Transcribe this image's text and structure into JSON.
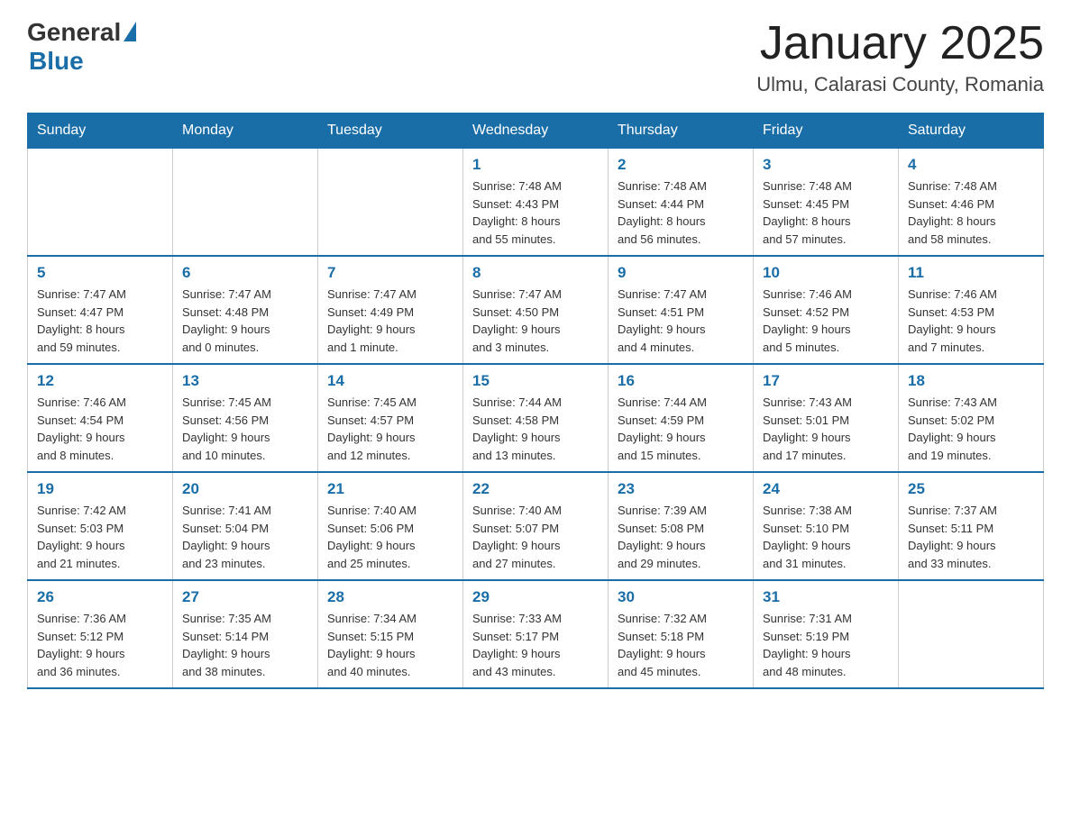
{
  "logo": {
    "general": "General",
    "blue": "Blue"
  },
  "title": "January 2025",
  "subtitle": "Ulmu, Calarasi County, Romania",
  "headers": [
    "Sunday",
    "Monday",
    "Tuesday",
    "Wednesday",
    "Thursday",
    "Friday",
    "Saturday"
  ],
  "weeks": [
    [
      {
        "day": "",
        "info": ""
      },
      {
        "day": "",
        "info": ""
      },
      {
        "day": "",
        "info": ""
      },
      {
        "day": "1",
        "info": "Sunrise: 7:48 AM\nSunset: 4:43 PM\nDaylight: 8 hours\nand 55 minutes."
      },
      {
        "day": "2",
        "info": "Sunrise: 7:48 AM\nSunset: 4:44 PM\nDaylight: 8 hours\nand 56 minutes."
      },
      {
        "day": "3",
        "info": "Sunrise: 7:48 AM\nSunset: 4:45 PM\nDaylight: 8 hours\nand 57 minutes."
      },
      {
        "day": "4",
        "info": "Sunrise: 7:48 AM\nSunset: 4:46 PM\nDaylight: 8 hours\nand 58 minutes."
      }
    ],
    [
      {
        "day": "5",
        "info": "Sunrise: 7:47 AM\nSunset: 4:47 PM\nDaylight: 8 hours\nand 59 minutes."
      },
      {
        "day": "6",
        "info": "Sunrise: 7:47 AM\nSunset: 4:48 PM\nDaylight: 9 hours\nand 0 minutes."
      },
      {
        "day": "7",
        "info": "Sunrise: 7:47 AM\nSunset: 4:49 PM\nDaylight: 9 hours\nand 1 minute."
      },
      {
        "day": "8",
        "info": "Sunrise: 7:47 AM\nSunset: 4:50 PM\nDaylight: 9 hours\nand 3 minutes."
      },
      {
        "day": "9",
        "info": "Sunrise: 7:47 AM\nSunset: 4:51 PM\nDaylight: 9 hours\nand 4 minutes."
      },
      {
        "day": "10",
        "info": "Sunrise: 7:46 AM\nSunset: 4:52 PM\nDaylight: 9 hours\nand 5 minutes."
      },
      {
        "day": "11",
        "info": "Sunrise: 7:46 AM\nSunset: 4:53 PM\nDaylight: 9 hours\nand 7 minutes."
      }
    ],
    [
      {
        "day": "12",
        "info": "Sunrise: 7:46 AM\nSunset: 4:54 PM\nDaylight: 9 hours\nand 8 minutes."
      },
      {
        "day": "13",
        "info": "Sunrise: 7:45 AM\nSunset: 4:56 PM\nDaylight: 9 hours\nand 10 minutes."
      },
      {
        "day": "14",
        "info": "Sunrise: 7:45 AM\nSunset: 4:57 PM\nDaylight: 9 hours\nand 12 minutes."
      },
      {
        "day": "15",
        "info": "Sunrise: 7:44 AM\nSunset: 4:58 PM\nDaylight: 9 hours\nand 13 minutes."
      },
      {
        "day": "16",
        "info": "Sunrise: 7:44 AM\nSunset: 4:59 PM\nDaylight: 9 hours\nand 15 minutes."
      },
      {
        "day": "17",
        "info": "Sunrise: 7:43 AM\nSunset: 5:01 PM\nDaylight: 9 hours\nand 17 minutes."
      },
      {
        "day": "18",
        "info": "Sunrise: 7:43 AM\nSunset: 5:02 PM\nDaylight: 9 hours\nand 19 minutes."
      }
    ],
    [
      {
        "day": "19",
        "info": "Sunrise: 7:42 AM\nSunset: 5:03 PM\nDaylight: 9 hours\nand 21 minutes."
      },
      {
        "day": "20",
        "info": "Sunrise: 7:41 AM\nSunset: 5:04 PM\nDaylight: 9 hours\nand 23 minutes."
      },
      {
        "day": "21",
        "info": "Sunrise: 7:40 AM\nSunset: 5:06 PM\nDaylight: 9 hours\nand 25 minutes."
      },
      {
        "day": "22",
        "info": "Sunrise: 7:40 AM\nSunset: 5:07 PM\nDaylight: 9 hours\nand 27 minutes."
      },
      {
        "day": "23",
        "info": "Sunrise: 7:39 AM\nSunset: 5:08 PM\nDaylight: 9 hours\nand 29 minutes."
      },
      {
        "day": "24",
        "info": "Sunrise: 7:38 AM\nSunset: 5:10 PM\nDaylight: 9 hours\nand 31 minutes."
      },
      {
        "day": "25",
        "info": "Sunrise: 7:37 AM\nSunset: 5:11 PM\nDaylight: 9 hours\nand 33 minutes."
      }
    ],
    [
      {
        "day": "26",
        "info": "Sunrise: 7:36 AM\nSunset: 5:12 PM\nDaylight: 9 hours\nand 36 minutes."
      },
      {
        "day": "27",
        "info": "Sunrise: 7:35 AM\nSunset: 5:14 PM\nDaylight: 9 hours\nand 38 minutes."
      },
      {
        "day": "28",
        "info": "Sunrise: 7:34 AM\nSunset: 5:15 PM\nDaylight: 9 hours\nand 40 minutes."
      },
      {
        "day": "29",
        "info": "Sunrise: 7:33 AM\nSunset: 5:17 PM\nDaylight: 9 hours\nand 43 minutes."
      },
      {
        "day": "30",
        "info": "Sunrise: 7:32 AM\nSunset: 5:18 PM\nDaylight: 9 hours\nand 45 minutes."
      },
      {
        "day": "31",
        "info": "Sunrise: 7:31 AM\nSunset: 5:19 PM\nDaylight: 9 hours\nand 48 minutes."
      },
      {
        "day": "",
        "info": ""
      }
    ]
  ]
}
